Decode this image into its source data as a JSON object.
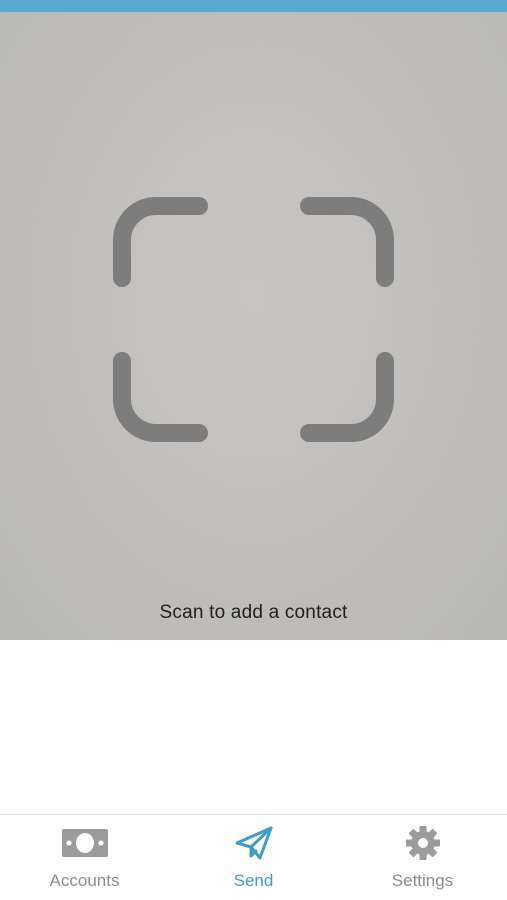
{
  "scanner": {
    "caption": "Scan to add a contact"
  },
  "nav": {
    "active": "send",
    "items": [
      {
        "id": "accounts",
        "label": "Accounts",
        "icon": "cash-icon"
      },
      {
        "id": "send",
        "label": "Send",
        "icon": "paper-plane-icon"
      },
      {
        "id": "settings",
        "label": "Settings",
        "icon": "gear-icon"
      }
    ]
  },
  "colors": {
    "accent": "#3d9ccb",
    "status_strip": "#5aa7cf",
    "inactive": "#8c8c8c",
    "frame": "#7d7d7d"
  }
}
